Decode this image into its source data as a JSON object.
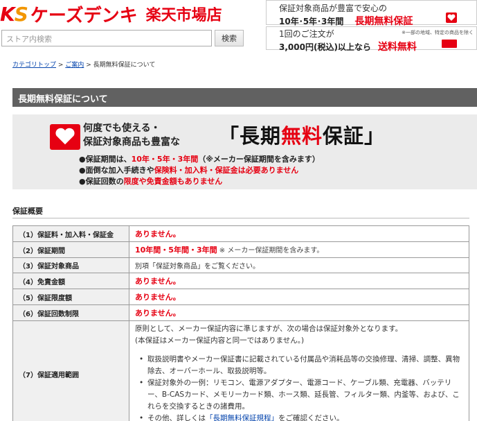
{
  "header": {
    "logo_ks": "K",
    "logo_s": "S",
    "logo_name": "ケーズデンキ",
    "logo_shop": "楽天市場店",
    "search_placeholder": "ストア内検索",
    "search_button": "検索"
  },
  "banner1": {
    "line1": "保証対象商品が豊富で安心の",
    "line2a": "10年･5年･3年間",
    "line2b": "長期無料保証"
  },
  "banner2": {
    "line1": "1回のご注文が",
    "note": "※一部の地域、特定の商品を除く",
    "line2a": "3,000円(税込)以上なら",
    "line2b": "送料無料"
  },
  "breadcrumb": {
    "top": "カテゴリトップ",
    "sep1": ">",
    "guide": "ご案内",
    "sep2": ">",
    "current": "長期無料保証について"
  },
  "section_title": "長期無料保証について",
  "promo": {
    "line1": "何度でも使える・",
    "line2": "保証対象商品も豊富な",
    "big_open": "「長期",
    "big_red": "無料",
    "big_close": "保証」",
    "b1a": "●保証期間は、",
    "b1b": "10年・5年・3年間",
    "b1c": "（※メーカー保証期間を含みます）",
    "b2a": "●面倒な加入手続きや",
    "b2b": "保険料・加入料・保証金は必要ありません",
    "b3a": "●保証回数の",
    "b3b": "限度や免責金額もありません"
  },
  "overview": {
    "title": "保証概要",
    "rows": [
      {
        "label": "（1）保証料・加入料・保証金",
        "value": "ありません。"
      },
      {
        "label": "（2）保証期間",
        "value": "10年間・5年間・3年間",
        "note": " ※ メーカー保証期間を含みます。"
      },
      {
        "label": "（3）保証対象商品",
        "value": "別項「保証対象商品」をご覧ください。"
      },
      {
        "label": "（4）免責金額",
        "value": "ありません。"
      },
      {
        "label": "（5）保証限度額",
        "value": "ありません。"
      },
      {
        "label": "（6）保証回数制限",
        "value": "ありません。"
      },
      {
        "label": "（7）保証適用範囲"
      }
    ],
    "scope": {
      "p1": "原則として、メーカー保証内容に準じますが、次の場合は保証対象外となります。",
      "p2": "(本保証はメーカー保証内容と同一ではありません。)",
      "li1": "取扱説明書やメーカー保証書に記載されている付属品や消耗品等の交換修理、清掃、調整、異物除去、オーバーホール、取扱説明等。",
      "li2": "保証対象外の一例：リモコン、電源アダプター、電源コード、ケーブル類、充電器、バッテリー、B-CASカード、メモリーカード類、ホース類、延長管、フィルター類、内釜等、および、これらを交換するときの諸費用。",
      "li3a": "その他、詳しくは",
      "li3_link": "「長期無料保証規程」",
      "li3b": "をご確認ください。"
    }
  }
}
